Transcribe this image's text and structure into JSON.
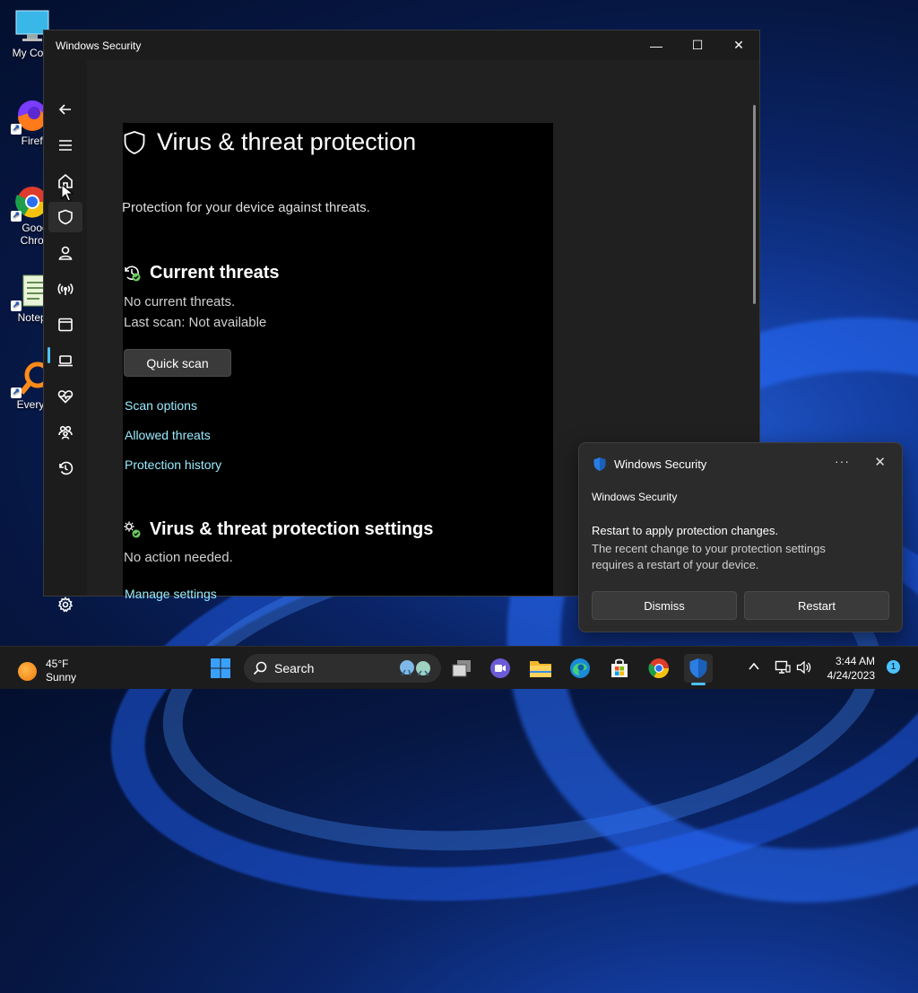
{
  "desktop": {
    "icons": [
      {
        "label": "My Com",
        "icon": "computer-icon"
      },
      {
        "label": "Firefo",
        "icon": "firefox-icon"
      },
      {
        "label": "Goog\nChron",
        "icon": "chrome-icon"
      },
      {
        "label": "Notepa",
        "icon": "notepad-icon"
      },
      {
        "label": "Everyth",
        "icon": "everything-icon"
      }
    ]
  },
  "window": {
    "title": "Windows Security",
    "controls": {
      "minimize": "—",
      "maximize": "☐",
      "close": "✕"
    }
  },
  "nav": {
    "items": [
      "back-icon",
      "menu-icon",
      "home-icon",
      "shield-icon",
      "person-icon",
      "wifi-icon",
      "app-browser-icon",
      "device-icon",
      "heart-icon",
      "family-icon",
      "history-icon",
      "settings-icon"
    ]
  },
  "page": {
    "title": "Virus & threat protection",
    "subtitle": "Protection for your device against threats.",
    "current_threats": {
      "heading": "Current threats",
      "status": "No current threats.",
      "last_scan": "Last scan: Not available",
      "quick_scan": "Quick scan",
      "links": [
        "Scan options",
        "Allowed threats",
        "Protection history"
      ]
    },
    "settings": {
      "heading": "Virus & threat protection settings",
      "status": "No action needed.",
      "link": "Manage settings"
    }
  },
  "toast": {
    "header": "Windows Security",
    "more": "···",
    "close": "✕",
    "app": "Windows Security",
    "message_title": "Restart to apply protection changes.",
    "message_body": "The recent change to your protection settings requires a restart of your device.",
    "dismiss": "Dismiss",
    "restart": "Restart"
  },
  "taskbar": {
    "weather_temp": "45°F",
    "weather_desc": "Sunny",
    "search_label": "Search",
    "time": "3:44 AM",
    "date": "4/24/2023",
    "notification_count": "1"
  },
  "colors": {
    "accent": "#4cc2ff",
    "link": "#99ebff",
    "window_bg": "#202020",
    "panel_bg": "#000000"
  }
}
